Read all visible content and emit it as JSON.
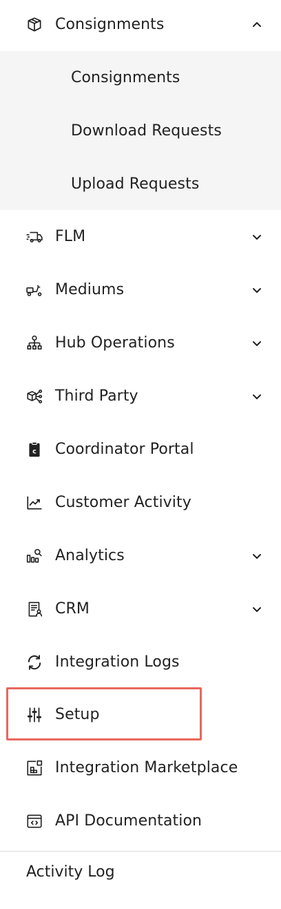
{
  "menu": {
    "consignments": {
      "label": "Consignments",
      "icon": "box-icon",
      "expanded": true,
      "children": [
        {
          "label": "Consignments"
        },
        {
          "label": "Download Requests"
        },
        {
          "label": "Upload Requests"
        }
      ]
    },
    "flm": {
      "label": "FLM",
      "icon": "truck-icon"
    },
    "mediums": {
      "label": "Mediums",
      "icon": "scooter-icon"
    },
    "hub_operations": {
      "label": "Hub Operations",
      "icon": "network-icon"
    },
    "third_party": {
      "label": "Third Party",
      "icon": "boxes-share-icon"
    },
    "coordinator_portal": {
      "label": "Coordinator Portal",
      "icon": "clipboard-c-icon"
    },
    "customer_activity": {
      "label": "Customer Activity",
      "icon": "line-chart-icon"
    },
    "analytics": {
      "label": "Analytics",
      "icon": "bar-search-icon"
    },
    "crm": {
      "label": "CRM",
      "icon": "document-user-icon"
    },
    "integration_logs": {
      "label": "Integration Logs",
      "icon": "refresh-icon"
    },
    "setup": {
      "label": "Setup",
      "icon": "sliders-icon",
      "highlighted": true
    },
    "integration_marketplace": {
      "label": "Integration Marketplace",
      "icon": "marketplace-icon"
    },
    "api_documentation": {
      "label": "API Documentation",
      "icon": "code-window-icon"
    }
  },
  "footer": {
    "activity_log": "Activity Log"
  },
  "colors": {
    "highlight": "#e8675c",
    "submenu_bg": "#f5f5f5"
  }
}
